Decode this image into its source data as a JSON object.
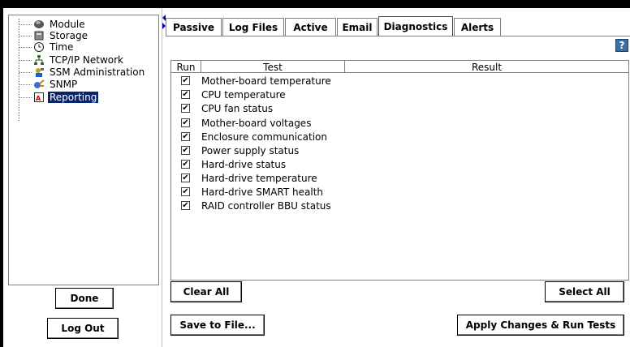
{
  "tree": {
    "items": [
      {
        "label": "Module",
        "icon": "module-icon"
      },
      {
        "label": "Storage",
        "icon": "storage-icon"
      },
      {
        "label": "Time",
        "icon": "clock-icon"
      },
      {
        "label": "TCP/IP Network",
        "icon": "network-icon"
      },
      {
        "label": "SSM Administration",
        "icon": "admin-icon"
      },
      {
        "label": "SNMP",
        "icon": "snmp-icon"
      },
      {
        "label": "Reporting",
        "icon": "reporting-icon",
        "selected": true
      }
    ]
  },
  "left_buttons": {
    "done": "Done",
    "logout": "Log Out"
  },
  "tabs": [
    {
      "label": "Passive"
    },
    {
      "label": "Log Files"
    },
    {
      "label": "Active"
    },
    {
      "label": "Email"
    },
    {
      "label": "Diagnostics",
      "active": true
    },
    {
      "label": "Alerts"
    }
  ],
  "help_label": "?",
  "table": {
    "headers": {
      "run": "Run",
      "test": "Test",
      "result": "Result"
    },
    "check_mark": "✔",
    "rows": [
      {
        "test": "Mother-board temperature",
        "checked": true,
        "result": ""
      },
      {
        "test": "CPU temperature",
        "checked": true,
        "result": ""
      },
      {
        "test": "CPU fan status",
        "checked": true,
        "result": ""
      },
      {
        "test": "Mother-board voltages",
        "checked": true,
        "result": ""
      },
      {
        "test": "Enclosure communication",
        "checked": true,
        "result": ""
      },
      {
        "test": "Power supply status",
        "checked": true,
        "result": ""
      },
      {
        "test": "Hard-drive status",
        "checked": true,
        "result": ""
      },
      {
        "test": "Hard-drive temperature",
        "checked": true,
        "result": ""
      },
      {
        "test": "Hard-drive SMART health",
        "checked": true,
        "result": ""
      },
      {
        "test": "RAID controller BBU status",
        "checked": true,
        "result": ""
      }
    ]
  },
  "buttons": {
    "clear_all": "Clear All",
    "select_all": "Select All",
    "save_to_file": "Save to File...",
    "apply": "Apply Changes & Run Tests"
  },
  "colors": {
    "selection": "#0a246a",
    "accent_arrow": "#0000c0",
    "help": "#3a6ea5"
  }
}
